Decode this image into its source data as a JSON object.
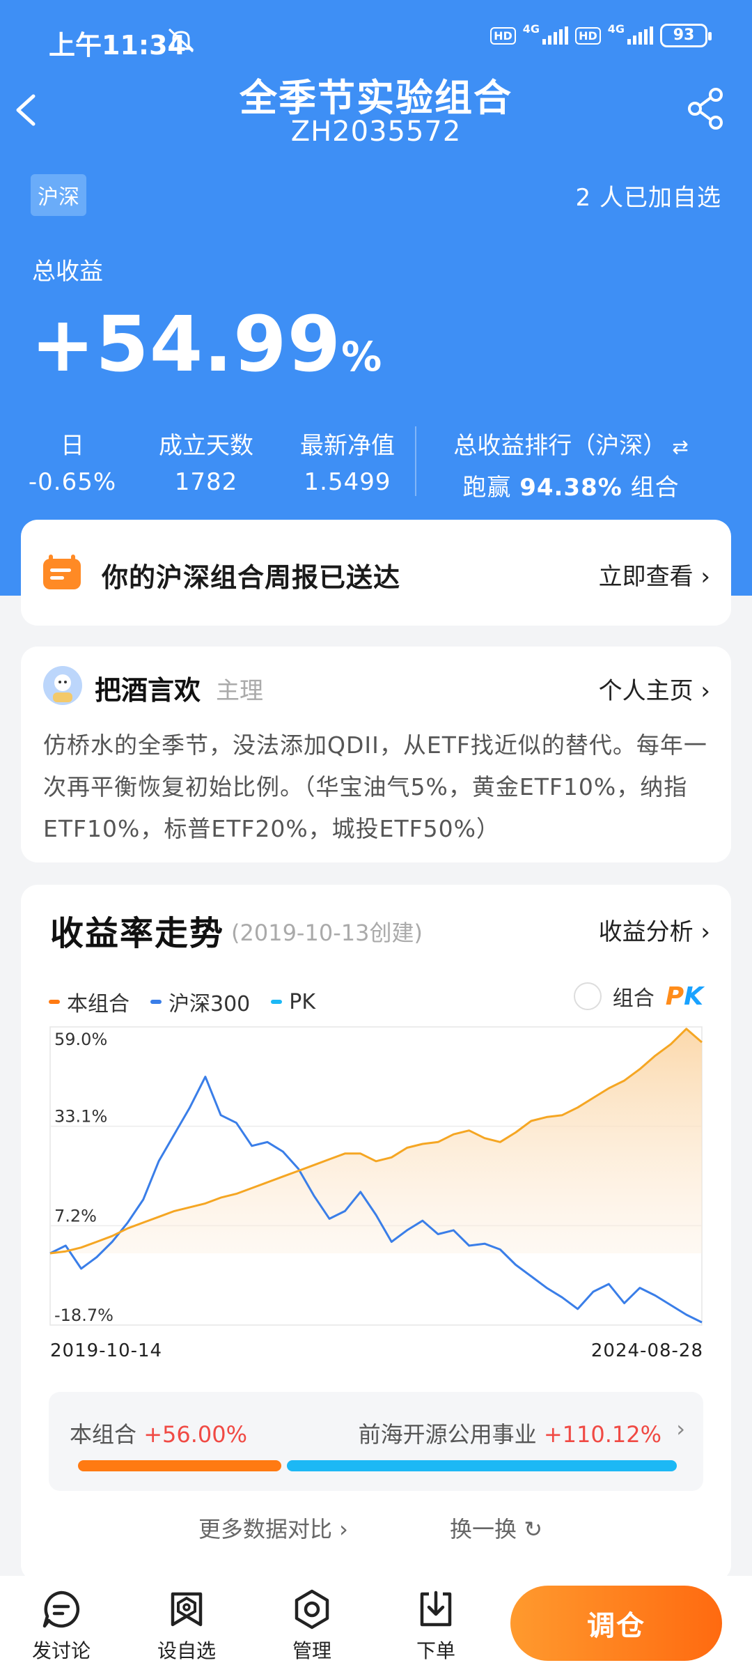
{
  "status_bar": {
    "time": "上午11:34",
    "network_1": "4G",
    "network_2": "4G",
    "hd_label": "HD",
    "battery": "93"
  },
  "header": {
    "title": "全季节实验组合",
    "code": "ZH2035572",
    "back_icon": "chevron-left-icon",
    "share_icon": "share-icon"
  },
  "portfolio": {
    "market_tag": "沪深",
    "followers": "2 人已加自选",
    "total_return_label": "总收益",
    "total_return_value": "+54.99",
    "total_return_unit": "%",
    "stats": {
      "day_label": "日",
      "day_value": "-0.65%",
      "days_label": "成立天数",
      "days_value": "1782",
      "nav_label": "最新净值",
      "nav_value": "1.5499",
      "rank_label": "总收益排行（沪深）",
      "rank_prefix": "跑赢",
      "rank_value": "94.38%",
      "rank_suffix": "组合"
    }
  },
  "notice": {
    "text": "你的沪深组合周报已送达",
    "link": "立即查看 ›"
  },
  "author": {
    "name": "把酒言欢",
    "role": "主理",
    "profile_link": "个人主页 ›",
    "description": "仿桥水的全季节，没法添加QDII，从ETF找近似的替代。每年一次再平衡恢复初始比例。（华宝油气5%，黄金ETF10%，纳指ETF10%，标普ETF20%，城投ETF50%）"
  },
  "chart_section": {
    "title": "收益率走势",
    "created": "(2019-10-13创建)",
    "analysis_link": "收益分析 ›",
    "pk_toggle_label": "组合",
    "pk_logo_p": "P",
    "pk_logo_k": "K",
    "date_start": "2019-10-14",
    "date_end": "2024-08-28"
  },
  "chart_data": {
    "type": "line",
    "x_start": "2019-10-14",
    "x_end": "2024-08-28",
    "ylim": [
      -18.7,
      59.0
    ],
    "y_ticks": [
      "59.0%",
      "33.1%",
      "7.2%",
      "-18.7%"
    ],
    "y_tick_values": [
      59.0,
      33.1,
      7.2,
      -18.7
    ],
    "legend": [
      {
        "name": "本组合",
        "color": "#ff7a12"
      },
      {
        "name": "沪深300",
        "color": "#3a7ee8"
      },
      {
        "name": "PK",
        "color": "#1cb8f5"
      }
    ],
    "series": [
      {
        "name": "本组合",
        "color": "#f5a623",
        "fill": true,
        "values": [
          0.0,
          0.5,
          1.5,
          3.0,
          4.5,
          6.5,
          8.0,
          9.5,
          11.0,
          12.0,
          13.0,
          14.5,
          15.5,
          17.0,
          18.5,
          20.0,
          21.5,
          23.0,
          24.5,
          26.0,
          26.0,
          24.0,
          25.0,
          27.5,
          28.5,
          29.0,
          31.0,
          32.0,
          30.0,
          29.0,
          31.5,
          34.5,
          35.5,
          36.0,
          38.0,
          40.5,
          43.0,
          45.0,
          48.0,
          51.5,
          54.5,
          58.5,
          54.99
        ]
      },
      {
        "name": "沪深300",
        "color": "#3a7ee8",
        "fill": false,
        "values": [
          0.0,
          2.0,
          -4.0,
          -1.0,
          3.0,
          8.0,
          14.0,
          24.0,
          31.0,
          38.0,
          46.0,
          36.0,
          34.0,
          28.0,
          29.0,
          26.5,
          22.0,
          15.0,
          9.0,
          11.0,
          16.0,
          10.0,
          3.0,
          6.0,
          8.5,
          5.0,
          6.0,
          2.0,
          2.5,
          1.0,
          -3.0,
          -6.0,
          -9.0,
          -11.5,
          -14.5,
          -10.0,
          -8.0,
          -13.0,
          -9.0,
          -11.0,
          -13.5,
          -16.0,
          -18.0
        ]
      }
    ],
    "comparison": {
      "left_label": "本组合",
      "left_value": "+56.00%",
      "right_label": "前海开源公用事业",
      "right_value": "+110.12%",
      "left_fraction": 0.34
    }
  },
  "footer_links": {
    "more": "更多数据对比 ›",
    "refresh": "换一换"
  },
  "tabbar": {
    "discuss": "发讨论",
    "watchlist": "设自选",
    "manage": "管理",
    "order": "下单",
    "rebalance": "调仓"
  }
}
